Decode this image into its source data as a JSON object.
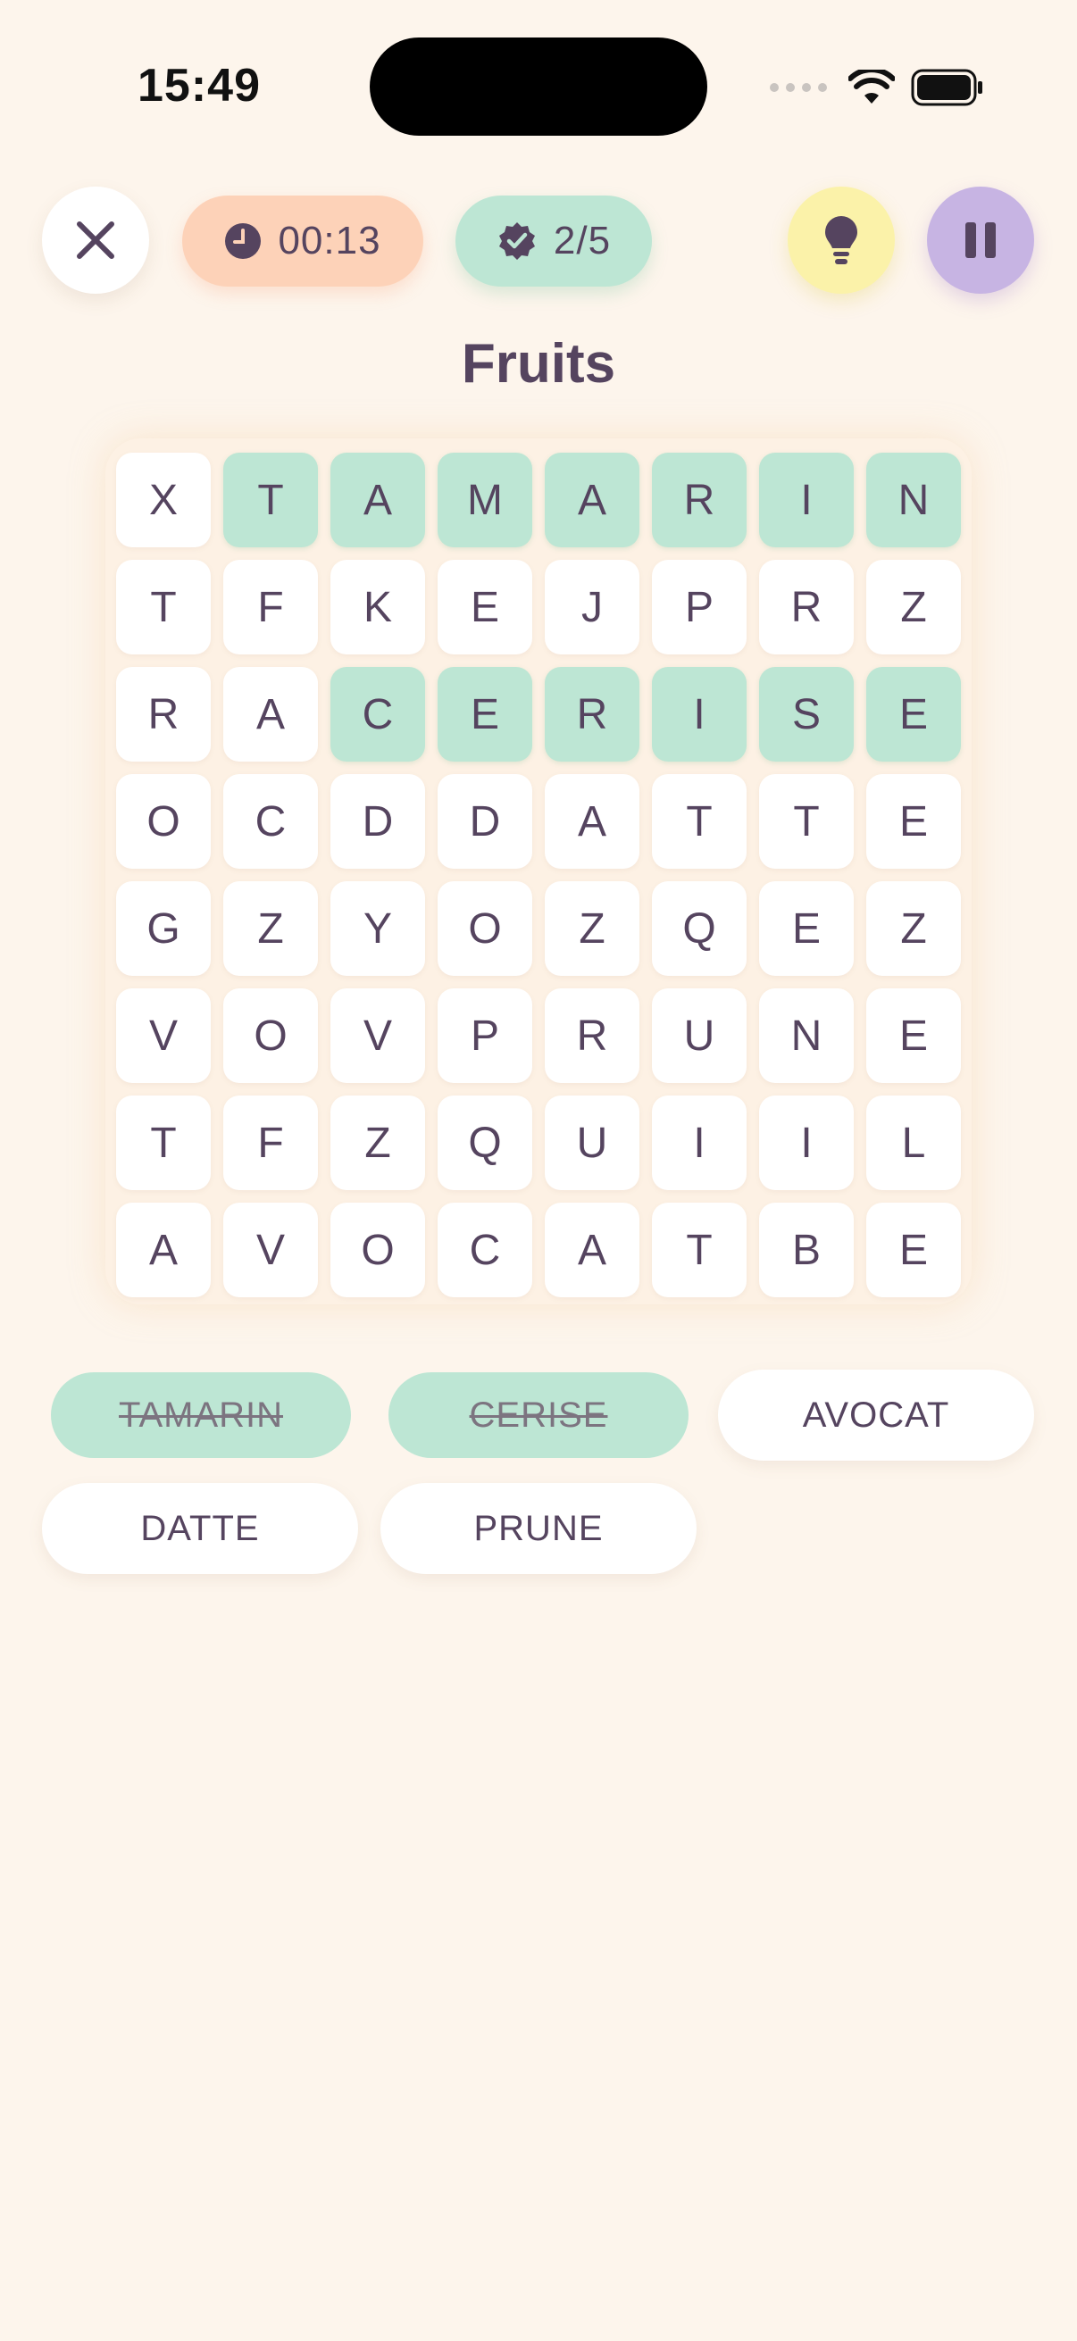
{
  "status_bar": {
    "time": "15:49"
  },
  "toolbar": {
    "timer": "00:13",
    "progress": "2/5"
  },
  "puzzle": {
    "title": "Fruits"
  },
  "grid": [
    [
      {
        "l": "X",
        "f": false
      },
      {
        "l": "T",
        "f": true
      },
      {
        "l": "A",
        "f": true
      },
      {
        "l": "M",
        "f": true
      },
      {
        "l": "A",
        "f": true
      },
      {
        "l": "R",
        "f": true
      },
      {
        "l": "I",
        "f": true
      },
      {
        "l": "N",
        "f": true
      }
    ],
    [
      {
        "l": "T",
        "f": false
      },
      {
        "l": "F",
        "f": false
      },
      {
        "l": "K",
        "f": false
      },
      {
        "l": "E",
        "f": false
      },
      {
        "l": "J",
        "f": false
      },
      {
        "l": "P",
        "f": false
      },
      {
        "l": "R",
        "f": false
      },
      {
        "l": "Z",
        "f": false
      }
    ],
    [
      {
        "l": "R",
        "f": false
      },
      {
        "l": "A",
        "f": false
      },
      {
        "l": "C",
        "f": true
      },
      {
        "l": "E",
        "f": true
      },
      {
        "l": "R",
        "f": true
      },
      {
        "l": "I",
        "f": true
      },
      {
        "l": "S",
        "f": true
      },
      {
        "l": "E",
        "f": true
      }
    ],
    [
      {
        "l": "O",
        "f": false
      },
      {
        "l": "C",
        "f": false
      },
      {
        "l": "D",
        "f": false
      },
      {
        "l": "D",
        "f": false
      },
      {
        "l": "A",
        "f": false
      },
      {
        "l": "T",
        "f": false
      },
      {
        "l": "T",
        "f": false
      },
      {
        "l": "E",
        "f": false
      }
    ],
    [
      {
        "l": "G",
        "f": false
      },
      {
        "l": "Z",
        "f": false
      },
      {
        "l": "Y",
        "f": false
      },
      {
        "l": "O",
        "f": false
      },
      {
        "l": "Z",
        "f": false
      },
      {
        "l": "Q",
        "f": false
      },
      {
        "l": "E",
        "f": false
      },
      {
        "l": "Z",
        "f": false
      }
    ],
    [
      {
        "l": "V",
        "f": false
      },
      {
        "l": "O",
        "f": false
      },
      {
        "l": "V",
        "f": false
      },
      {
        "l": "P",
        "f": false
      },
      {
        "l": "R",
        "f": false
      },
      {
        "l": "U",
        "f": false
      },
      {
        "l": "N",
        "f": false
      },
      {
        "l": "E",
        "f": false
      }
    ],
    [
      {
        "l": "T",
        "f": false
      },
      {
        "l": "F",
        "f": false
      },
      {
        "l": "Z",
        "f": false
      },
      {
        "l": "Q",
        "f": false
      },
      {
        "l": "U",
        "f": false
      },
      {
        "l": "I",
        "f": false
      },
      {
        "l": "I",
        "f": false
      },
      {
        "l": "L",
        "f": false
      }
    ],
    [
      {
        "l": "A",
        "f": false
      },
      {
        "l": "V",
        "f": false
      },
      {
        "l": "O",
        "f": false
      },
      {
        "l": "C",
        "f": false
      },
      {
        "l": "A",
        "f": false
      },
      {
        "l": "T",
        "f": false
      },
      {
        "l": "B",
        "f": false
      },
      {
        "l": "E",
        "f": false
      }
    ]
  ],
  "words": [
    {
      "label": "TAMARIN",
      "found": true
    },
    {
      "label": "CERISE",
      "found": true
    },
    {
      "label": "AVOCAT",
      "found": false
    },
    {
      "label": "DATTE",
      "found": false
    },
    {
      "label": "PRUNE",
      "found": false
    }
  ],
  "icons": {
    "close": "close-icon",
    "timer": "clock-icon",
    "progress": "verified-badge-icon",
    "hint": "lightbulb-icon",
    "pause": "pause-icon"
  },
  "colors": {
    "background": "#fdf5ec",
    "found": "#bde6d4",
    "timer_pill": "#fdd2b8",
    "hint_button": "#fbf2a9",
    "pause_button": "#c7b4e3",
    "text": "#55445f"
  }
}
